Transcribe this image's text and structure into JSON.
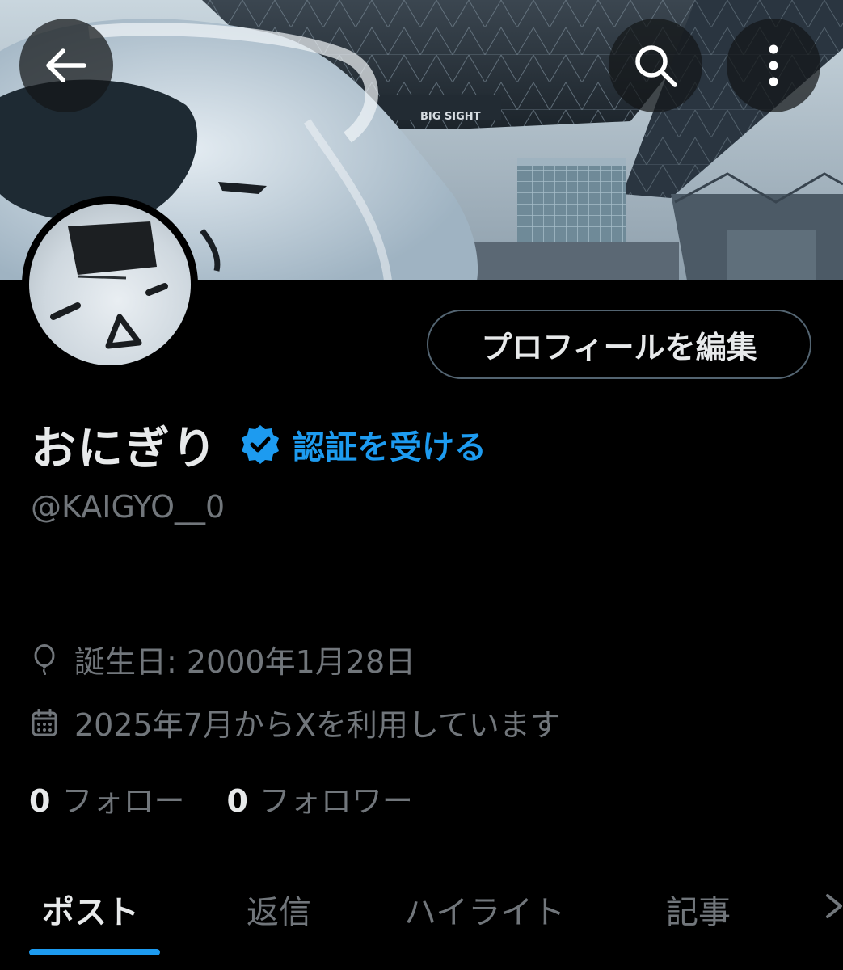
{
  "header": {
    "back_icon": "arrow-left-icon",
    "search_icon": "search-icon",
    "more_icon": "more-vertical-icon",
    "banner_sign": "BIG SIGHT"
  },
  "profile": {
    "edit_label": "プロフィールを編集",
    "display_name": "おにぎり",
    "verify_icon": "verified-badge-icon",
    "verify_label": "認証を受ける",
    "handle": "@KAIGYO__0",
    "birthday": "誕生日: 2000年1月28日",
    "joined": "2025年7月からXを利用しています",
    "following_count": "0",
    "following_label": "フォロー",
    "followers_count": "0",
    "followers_label": "フォロワー"
  },
  "tabs": [
    {
      "label": "ポスト",
      "active": true
    },
    {
      "label": "返信",
      "active": false
    },
    {
      "label": "ハイライト",
      "active": false
    },
    {
      "label": "記事",
      "active": false
    }
  ],
  "colors": {
    "background": "#000000",
    "primary_text": "#e7e9ea",
    "secondary_text": "#71767b",
    "accent": "#1d9bf0",
    "border": "#536471"
  }
}
